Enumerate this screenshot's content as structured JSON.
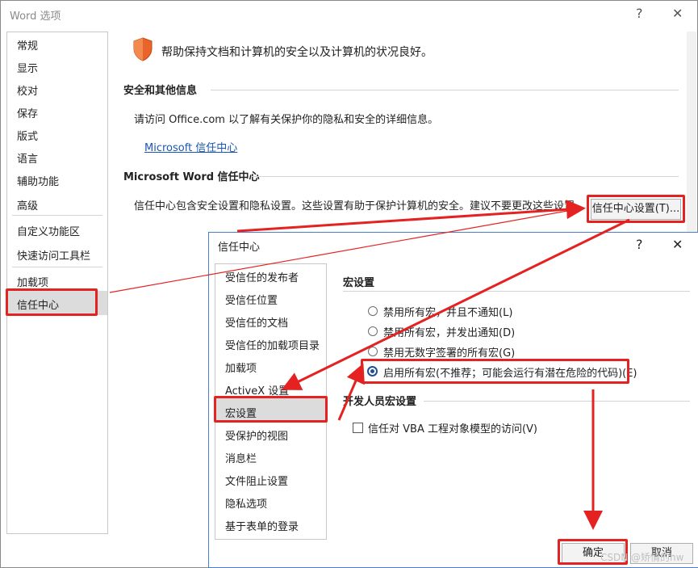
{
  "word_options": {
    "title": "Word 选项",
    "help_symbol": "?",
    "close_symbol": "✕",
    "nav": [
      "常规",
      "显示",
      "校对",
      "保存",
      "版式",
      "语言",
      "辅助功能",
      "高级",
      "自定义功能区",
      "快速访问工具栏",
      "加载项",
      "信任中心"
    ],
    "selected_nav": "信任中心",
    "banner_text": "帮助保持文档和计算机的安全以及计算机的状况良好。",
    "security_heading": "安全和其他信息",
    "security_text": "请访问 Office.com 以了解有关保护你的隐私和安全的详细信息。",
    "ms_link": "Microsoft 信任中心",
    "trust_heading": "Microsoft Word 信任中心",
    "trust_text": "信任中心包含安全设置和隐私设置。这些设置有助于保护计算机的安全。建议不要更改这些设置。",
    "trust_button": "信任中心设置(T)..."
  },
  "trust_center": {
    "title": "信任中心",
    "help_symbol": "?",
    "close_symbol": "✕",
    "nav": [
      "受信任的发布者",
      "受信任位置",
      "受信任的文档",
      "受信任的加载项目录",
      "加载项",
      "ActiveX 设置",
      "宏设置",
      "受保护的视图",
      "消息栏",
      "文件阻止设置",
      "隐私选项",
      "基于表单的登录"
    ],
    "selected_nav": "宏设置",
    "macro_heading": "宏设置",
    "macro_options": [
      {
        "label": "禁用所有宏，并且不通知(L)",
        "selected": false
      },
      {
        "label": "禁用所有宏，并发出通知(D)",
        "selected": false
      },
      {
        "label": "禁用无数字签署的所有宏(G)",
        "selected": false
      },
      {
        "label": "启用所有宏(不推荐；可能会运行有潜在危险的代码)(E)",
        "selected": true
      }
    ],
    "dev_heading": "开发人员宏设置",
    "vba_checkbox": "信任对 VBA 工程对象模型的访问(V)",
    "vba_checked": false,
    "ok_button": "确定",
    "cancel_button": "取消"
  },
  "watermark": "CSDN @矫情的hw",
  "colors": {
    "highlight": "#e52222",
    "shield": "#e8642a",
    "link": "#1a56b6",
    "dialog_border": "#4a7fc7"
  }
}
